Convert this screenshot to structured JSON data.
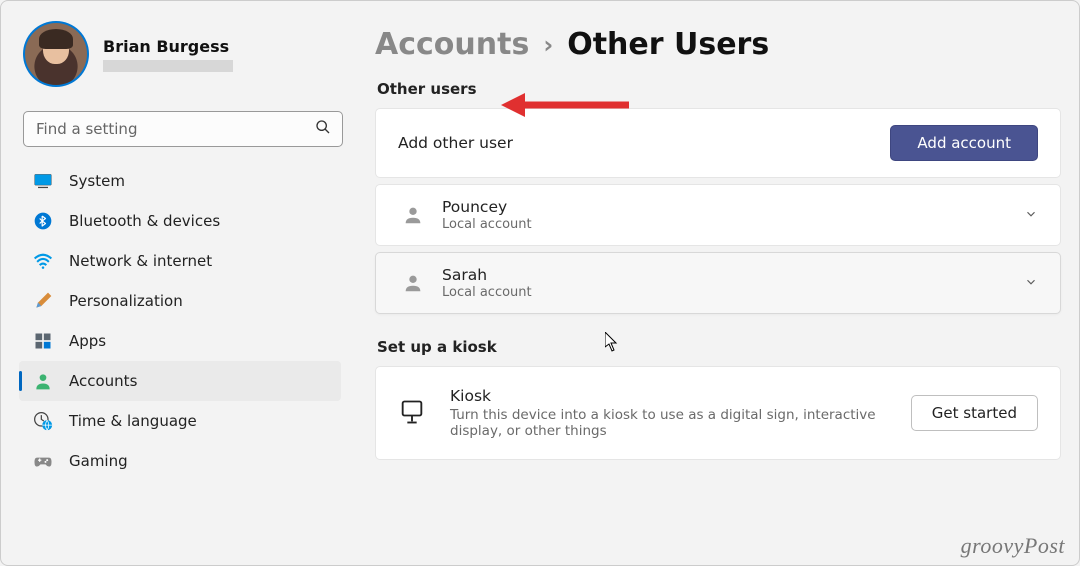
{
  "profile": {
    "name": "Brian Burgess"
  },
  "search": {
    "placeholder": "Find a setting"
  },
  "sidebar": {
    "items": [
      {
        "label": "System"
      },
      {
        "label": "Bluetooth & devices"
      },
      {
        "label": "Network & internet"
      },
      {
        "label": "Personalization"
      },
      {
        "label": "Apps"
      },
      {
        "label": "Accounts"
      },
      {
        "label": "Time & language"
      },
      {
        "label": "Gaming"
      }
    ]
  },
  "breadcrumb": {
    "parent": "Accounts",
    "separator": "›",
    "current": "Other Users"
  },
  "sections": {
    "other_users_heading": "Other users",
    "add_other_user": {
      "label": "Add other user",
      "button": "Add account"
    },
    "users": [
      {
        "name": "Pouncey",
        "type": "Local account"
      },
      {
        "name": "Sarah",
        "type": "Local account"
      }
    ],
    "kiosk_heading": "Set up a kiosk",
    "kiosk": {
      "title": "Kiosk",
      "description": "Turn this device into a kiosk to use as a digital sign, interactive display, or other things",
      "button": "Get started"
    }
  },
  "watermark": "groovyPost"
}
